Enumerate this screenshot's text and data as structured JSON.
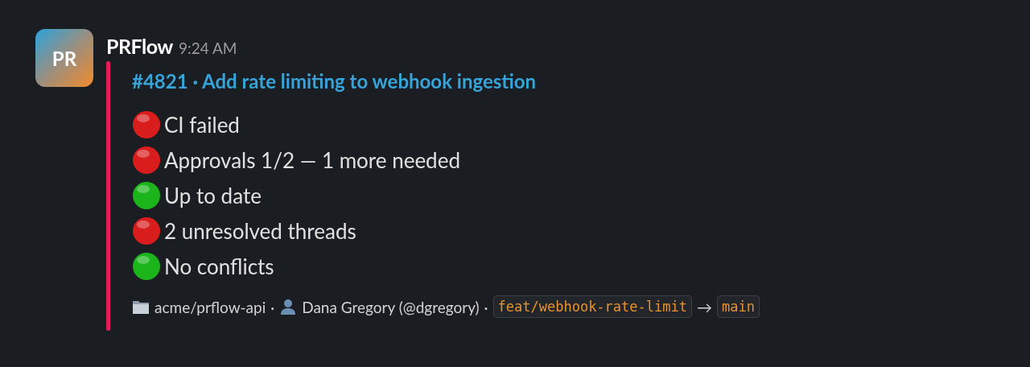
{
  "message": {
    "avatar_text": "PR",
    "sender": "PRFlow",
    "time": "9:24 AM"
  },
  "attachment": {
    "title": "#4821 · Add rate limiting to webhook ingestion",
    "checks": [
      {
        "label": "CI failed",
        "color": "#d91c1c"
      },
      {
        "label": "Approvals 1/2 — 1 more needed",
        "color": "#d91c1c"
      },
      {
        "label": "Up to date",
        "color": "#1bb51b"
      },
      {
        "label": "2 unresolved threads",
        "color": "#d91c1c"
      },
      {
        "label": "No conflicts",
        "color": "#1bb51b"
      }
    ],
    "footer": {
      "repo": "acme/prflow-api",
      "separator_1": "·",
      "author": "Dana Gregory (@dgregory)",
      "separator_2": "·",
      "head_branch": "feat/webhook-rate-limit",
      "arrow": "→",
      "base_branch": "main"
    }
  }
}
